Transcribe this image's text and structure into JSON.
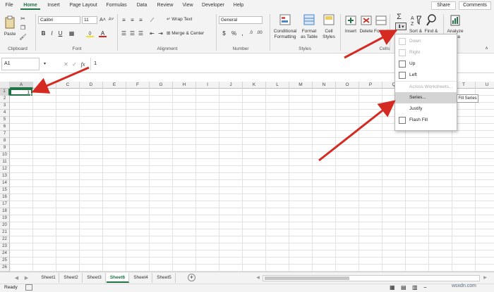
{
  "tabs": [
    "File",
    "Home",
    "Insert",
    "Page Layout",
    "Formulas",
    "Data",
    "Review",
    "View",
    "Developer",
    "Help"
  ],
  "active_tab": "Home",
  "share_label": "Share",
  "comments_label": "Comments",
  "ribbon": {
    "clipboard": {
      "paste": "Paste",
      "group": "Clipboard"
    },
    "font": {
      "name": "Calibri",
      "size": "11",
      "group": "Font"
    },
    "alignment": {
      "wrap": "Wrap Text",
      "merge": "Merge & Center",
      "group": "Alignment"
    },
    "number": {
      "format": "General",
      "group": "Number"
    },
    "styles": {
      "conditional": "Conditional Formatting",
      "table": "Format as Table",
      "cell_styles": "Cell Styles",
      "group": "Styles"
    },
    "cells": {
      "insert": "Insert",
      "delete": "Delete",
      "format": "Format",
      "group": "Cells"
    },
    "editing": {
      "sort": "Sort &",
      "find": "Find &"
    },
    "analyze": {
      "label": "Analyze Data"
    }
  },
  "formula_bar": {
    "name_box": "A1",
    "value": "1"
  },
  "columns": [
    "A",
    "B",
    "C",
    "D",
    "E",
    "F",
    "G",
    "H",
    "I",
    "J",
    "K",
    "L",
    "M",
    "N",
    "O",
    "P",
    "Q",
    "R",
    "S",
    "T",
    "U",
    "V",
    "W"
  ],
  "rows": [
    "1",
    "2",
    "3",
    "4",
    "5",
    "6",
    "7",
    "8",
    "9",
    "10",
    "11",
    "12",
    "13",
    "14",
    "15",
    "16",
    "17",
    "18",
    "19",
    "20",
    "21",
    "22",
    "23",
    "24",
    "25",
    "26",
    "27"
  ],
  "cell_a1": "1",
  "fill_menu": {
    "items": [
      {
        "label": "Down",
        "disabled": true
      },
      {
        "label": "Right",
        "disabled": true
      },
      {
        "label": "Up",
        "disabled": false
      },
      {
        "label": "Left",
        "disabled": false
      },
      {
        "label": "Across Worksheets...",
        "disabled": true
      },
      {
        "label": "Series...",
        "disabled": false,
        "highlighted": true
      },
      {
        "label": "Justify",
        "disabled": false
      },
      {
        "label": "Flash Fill",
        "disabled": false
      }
    ],
    "tooltip": "Fill Series"
  },
  "sheets": [
    "Sheet1",
    "Sheet2",
    "Sheet3",
    "Sheet6",
    "Sheet4",
    "Sheet5"
  ],
  "active_sheet": "Sheet6",
  "status": {
    "ready": "Ready"
  },
  "watermark": "wsxdn.com",
  "colors": {
    "accent": "#217346",
    "arrow": "#d42a22"
  }
}
